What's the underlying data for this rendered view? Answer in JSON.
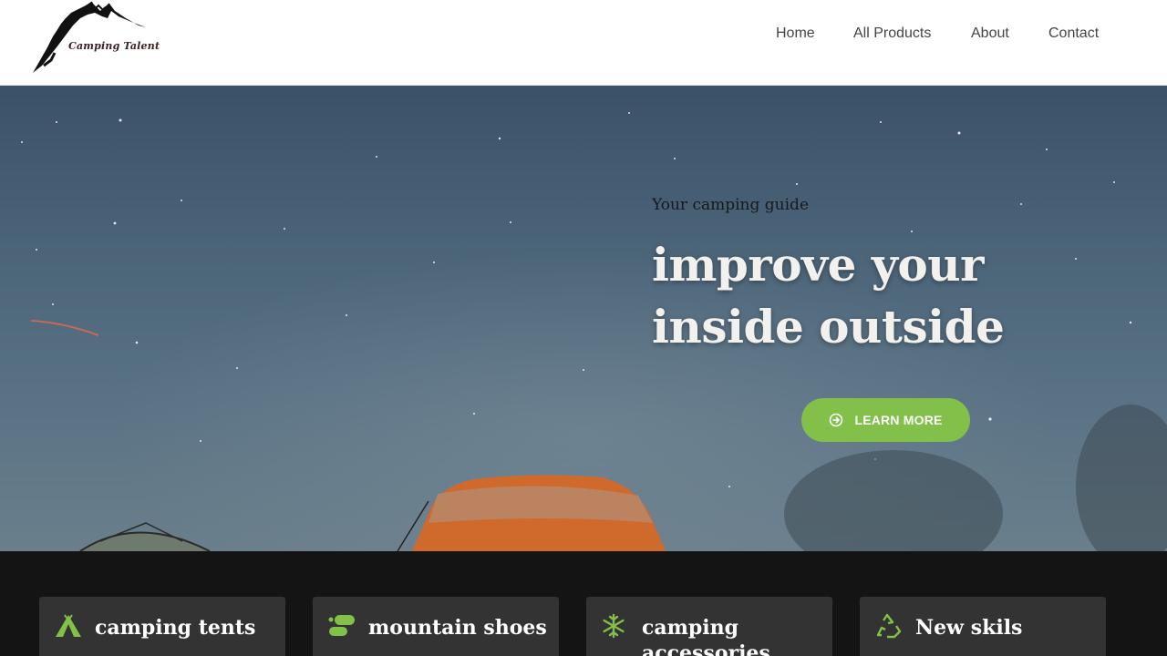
{
  "brand": {
    "logo_text": "Camping Talent"
  },
  "nav": {
    "items": [
      "Home",
      "All Products",
      "About",
      "Contact"
    ]
  },
  "hero": {
    "eyebrow": "Your camping guide",
    "title_line1": "improve your",
    "title_line2": "inside outside",
    "button_label": "LEARN MORE",
    "button_icon": "arrow-circle-right-icon"
  },
  "features": [
    {
      "icon": "tent-icon",
      "title": "camping tents"
    },
    {
      "icon": "footprints-icon",
      "title": "mountain shoes"
    },
    {
      "icon": "snowflake-icon",
      "title": "camping accessories"
    },
    {
      "icon": "recycle-icon",
      "title": "New skils"
    }
  ],
  "colors": {
    "accent": "#82c04a",
    "dark_band": "#141414",
    "card_bg": "#333333"
  }
}
